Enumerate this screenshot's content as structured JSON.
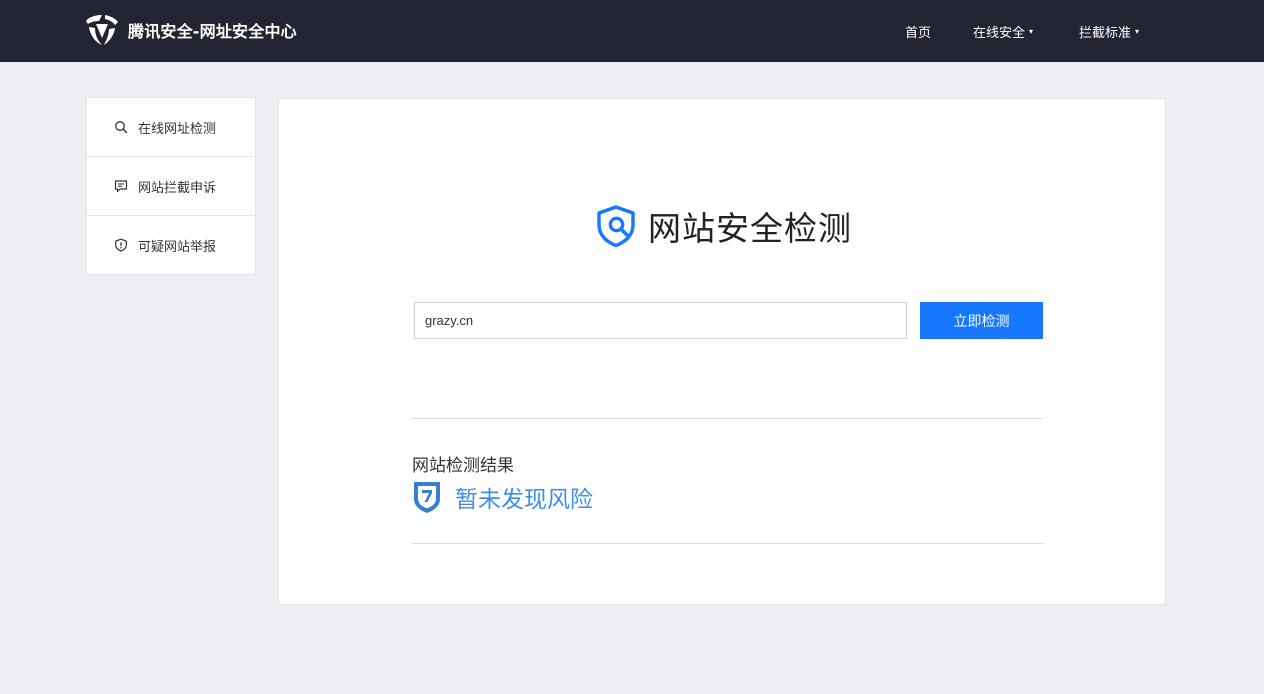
{
  "header": {
    "brand_title": "腾讯安全-网址安全中心",
    "nav": {
      "home": "首页",
      "online_security": "在线安全",
      "block_standard": "拦截标准",
      "caret": "▾"
    }
  },
  "sidebar": {
    "items": [
      {
        "label": "在线网址检测",
        "icon": "search-icon"
      },
      {
        "label": "网站拦截申诉",
        "icon": "chat-bubble-icon"
      },
      {
        "label": "可疑网站举报",
        "icon": "shield-alert-icon"
      }
    ]
  },
  "main": {
    "title": "网站安全检测",
    "search": {
      "value": "grazy.cn",
      "placeholder": ""
    },
    "button_label": "立即检测",
    "result_label": "网站检测结果",
    "result_text": "暂未发现风险"
  },
  "colors": {
    "topbar": "#222431",
    "accent": "#1677ff",
    "result_text": "#3d8ee8",
    "background": "#efeff3"
  }
}
